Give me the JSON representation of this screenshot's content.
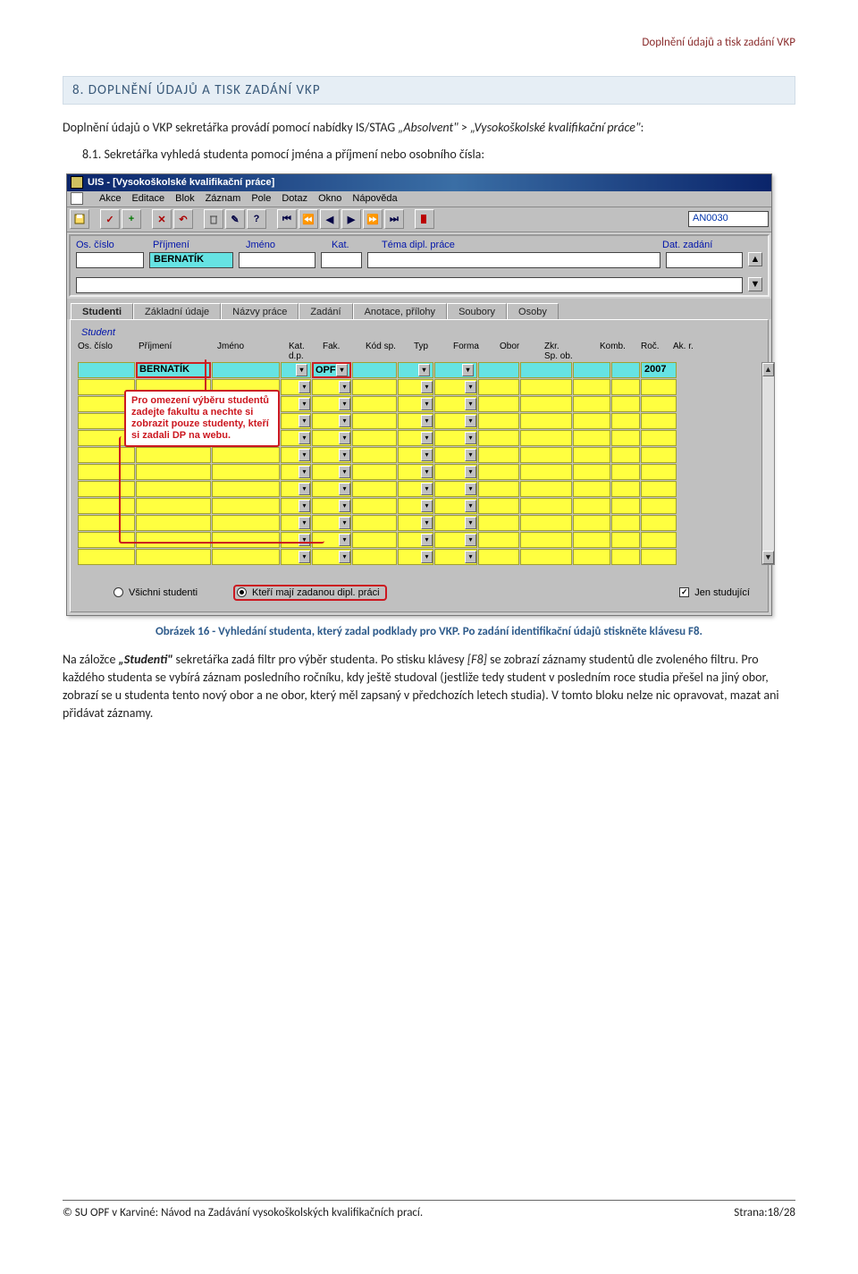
{
  "header_right": "Doplnění údajů a tisk zadání VKP",
  "section_heading": "8. DOPLNĚNÍ ÚDAJŮ A TISK ZADÁNÍ VKP",
  "intro": "Doplnění údajů o VKP sekretářka provádí pomocí nabídky IS/STAG „Absolvent\" > „Vysokoškolské kvalifikační práce\":",
  "step_number": "8.1.",
  "step_text": "Sekretářka vyhledá studenta pomocí jména a příjmení nebo osobního čísla:",
  "caption": "Obrázek 16 - Vyhledání studenta, který zadal podklady pro VKP. Po zadání identifikační údajů stiskněte klávesu F8.",
  "para_rest": "Na záložce „Studenti\" sekretářka zadá filtr pro výběr studenta. Po stisku klávesy [F8] se zobrazí záznamy studentů dle zvoleného filtru. Pro každého studenta se vybírá záznam posledního ročníku, kdy ještě studoval (jestliže tedy student v posledním roce studia přešel na jiný obor, zobrazí se u studenta tento nový obor a ne obor, který měl zapsaný v předchozích letech studia). V tomto bloku nelze nic opravovat, mazat ani přidávat záznamy.",
  "screenshot": {
    "title": "UIS - [Vysokoškolské kvalifikační práce]",
    "menu": [
      "Akce",
      "Editace",
      "Blok",
      "Záznam",
      "Pole",
      "Dotaz",
      "Okno",
      "Nápověda"
    ],
    "code_field": "AN0030",
    "top_headers": {
      "os": "Os. číslo",
      "pr": "Příjmení",
      "jm": "Jméno",
      "kat": "Kat.",
      "tema": "Téma dipl. práce",
      "dat": "Dat. zadání"
    },
    "top_row": {
      "prijmeni": "BERNATÍK"
    },
    "tabs": [
      "Studenti",
      "Základní údaje",
      "Názvy práce",
      "Zadání",
      "Anotace, přílohy",
      "Soubory",
      "Osoby"
    ],
    "active_tab": 0,
    "group_title": "Student",
    "grid_headers": [
      "Os. číslo",
      "Příjmení",
      "Jméno",
      "Kat.\nd.p.",
      "Fak.",
      "Kód sp.",
      "Typ",
      "Forma",
      "Obor",
      "Zkr.\nSp. ob.",
      "Komb.",
      "Roč.",
      "Ak. r."
    ],
    "grid_first_row": {
      "prijmeni": "BERNATÍK",
      "fak": "OPF",
      "akr": "2007"
    },
    "callout": "Pro omezení výběru studentů zadejte fakultu a nechte si zobrazit pouze studenty, kteří si zadali DP na webu.",
    "radios": {
      "all": "Všichni studenti",
      "have": "Kteří mají zadanou dipl. práci",
      "study": "Jen studující"
    }
  },
  "footer_left": "© SU OPF v Karviné: Návod na Zadávání vysokoškolských kvalifikačních prací.",
  "footer_right": "Strana:18/28"
}
